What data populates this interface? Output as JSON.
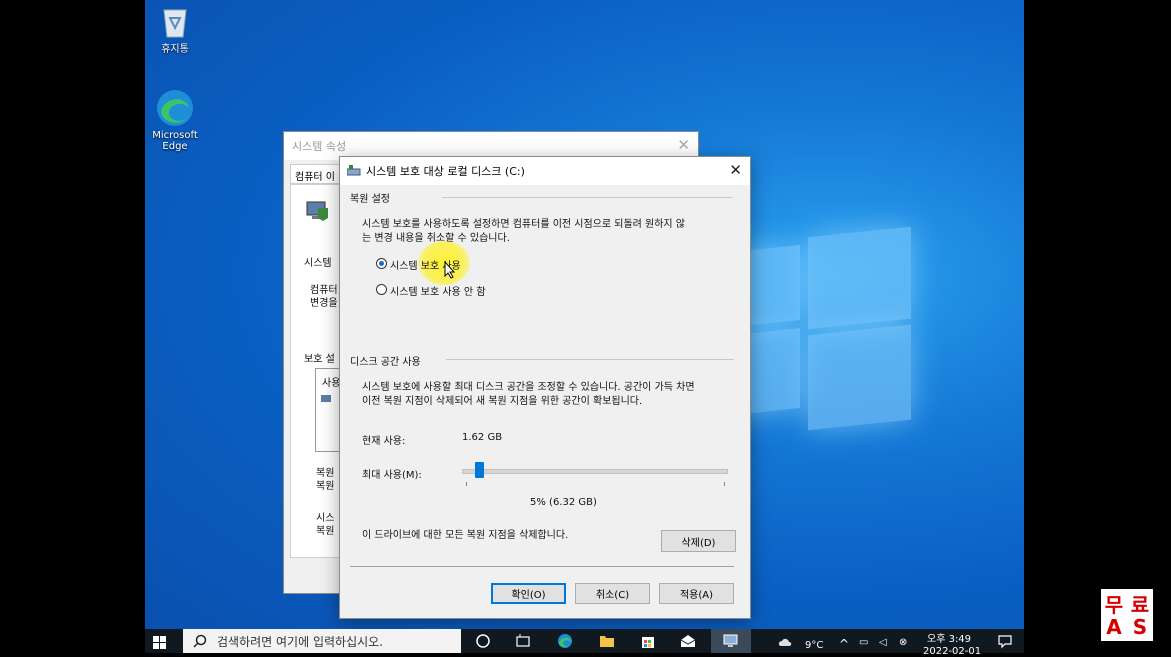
{
  "desktop": {
    "icons": [
      {
        "label": "휴지통",
        "name": "recycle-bin"
      },
      {
        "label": "Microsoft Edge",
        "name": "microsoft-edge"
      }
    ]
  },
  "back_window": {
    "title": "시스템 속성",
    "tab_label": "컴퓨터 이",
    "labels": [
      "시스템",
      "컴퓨터",
      "변경을",
      "보호 설",
      "사용",
      "복원",
      "복원",
      "시스",
      "복원"
    ]
  },
  "dialog": {
    "title": "시스템 보호 대상 로컬 디스크 (C:)",
    "restore": {
      "heading": "복원 설정",
      "desc_line1": "시스템 보호를 사용하도록 설정하면 컴퓨터를 이전 시점으로 되돌려 원하지 않",
      "desc_line2": "는 변경 내용을 취소할 수 있습니다.",
      "option_on": "시스템 보호 사용",
      "option_off": "시스템 보호 사용 안 함",
      "selected": "on"
    },
    "disk": {
      "heading": "디스크 공간 사용",
      "desc_line1": "시스템 보호에 사용할 최대 디스크 공간을 조정할 수 있습니다. 공간이 가득 차면",
      "desc_line2": "이전 복원 지점이 삭제되어 새 복원 지점을 위한 공간이 확보됩니다.",
      "current_label": "현재 사용:",
      "current_value": "1.62 GB",
      "max_label": "최대 사용(M):",
      "slider_percent": 5,
      "slider_value_text": "5% (6.32 GB)",
      "delete_desc": "이 드라이브에 대한 모든 복원 지점을 삭제합니다.",
      "delete_button": "삭제(D)"
    },
    "buttons": {
      "ok": "확인(O)",
      "cancel": "취소(C)",
      "apply": "적용(A)"
    }
  },
  "taskbar": {
    "search_placeholder": "검색하려면 여기에 입력하십시오.",
    "weather": "9°C",
    "time": "오후 3:49",
    "date": "2022-02-01"
  },
  "overlay_badge": {
    "chars": [
      "무",
      "료",
      "A",
      "S"
    ],
    "color": "#d60000"
  }
}
